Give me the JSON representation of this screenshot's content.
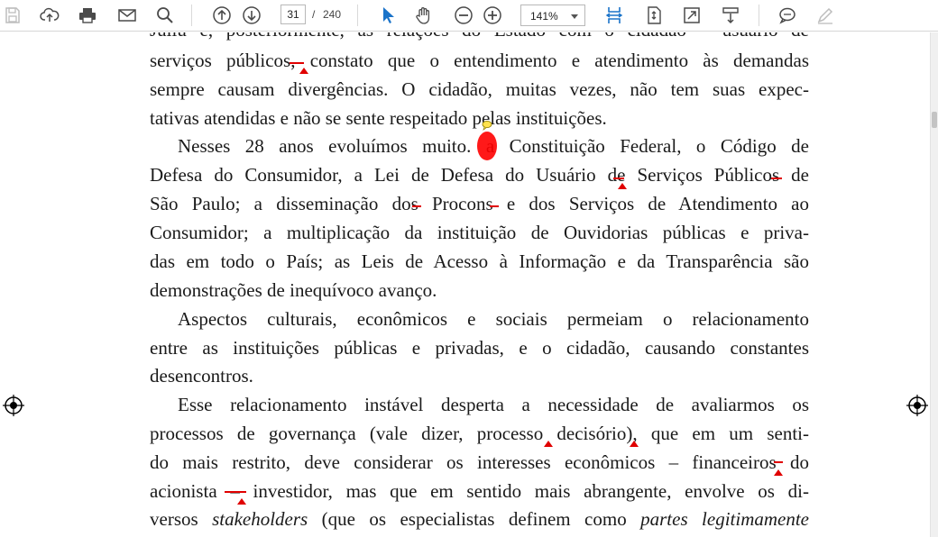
{
  "toolbar": {
    "page_current": "31",
    "page_separator": "/",
    "page_total": "240",
    "zoom_value": "141%"
  },
  "document": {
    "lines": [
      "Juliu e, posteriormente, as relações do Estado com o cidadão – usuário de",
      "serviços públicos, constato que o entendimento e atendimento às demandas",
      "sempre causam divergências. O cidadão, muitas vezes, não tem suas expec-",
      "tativas atendidas e não se sente respeitado pelas instituições.",
      "Nesses 28 anos evoluímos muito. a Constituição Federal, o Código de",
      "Defesa do Consumidor, a Lei de Defesa do Usuário de Serviços Públicos de",
      "São Paulo; a disseminação dos Procons e dos Serviços de Atendimento ao",
      "Consumidor; a multiplicação da instituição de Ouvidorias públicas e priva-",
      "das em todo o País; as Leis de Acesso à Informação e da Transparência são",
      "demonstrações de inequívoco avanço.",
      "Aspectos culturais, econômicos e sociais permeiam o relacionamento",
      "entre as instituições públicas e privadas, e o cidadão, causando constantes",
      "desencontros.",
      "Esse relacionamento instável desperta a necessidade de avaliarmos os",
      "processos de governança (vale dizer, processo decisório), que em um senti-",
      "do mais restrito, deve considerar os interesses econômicos – financeiros do",
      "acionista – investidor, mas que em sentido mais abrangente, envolve os di-"
    ],
    "last_line": {
      "before": "versos ",
      "italic1": "stakeholders",
      "middle": " (que os especialistas definem como ",
      "italic2": "partes legitimamente"
    }
  },
  "colors": {
    "annotation_red": "#e00000",
    "icon_blue": "#1a73c9",
    "icon_gray": "#4a4a4a"
  }
}
